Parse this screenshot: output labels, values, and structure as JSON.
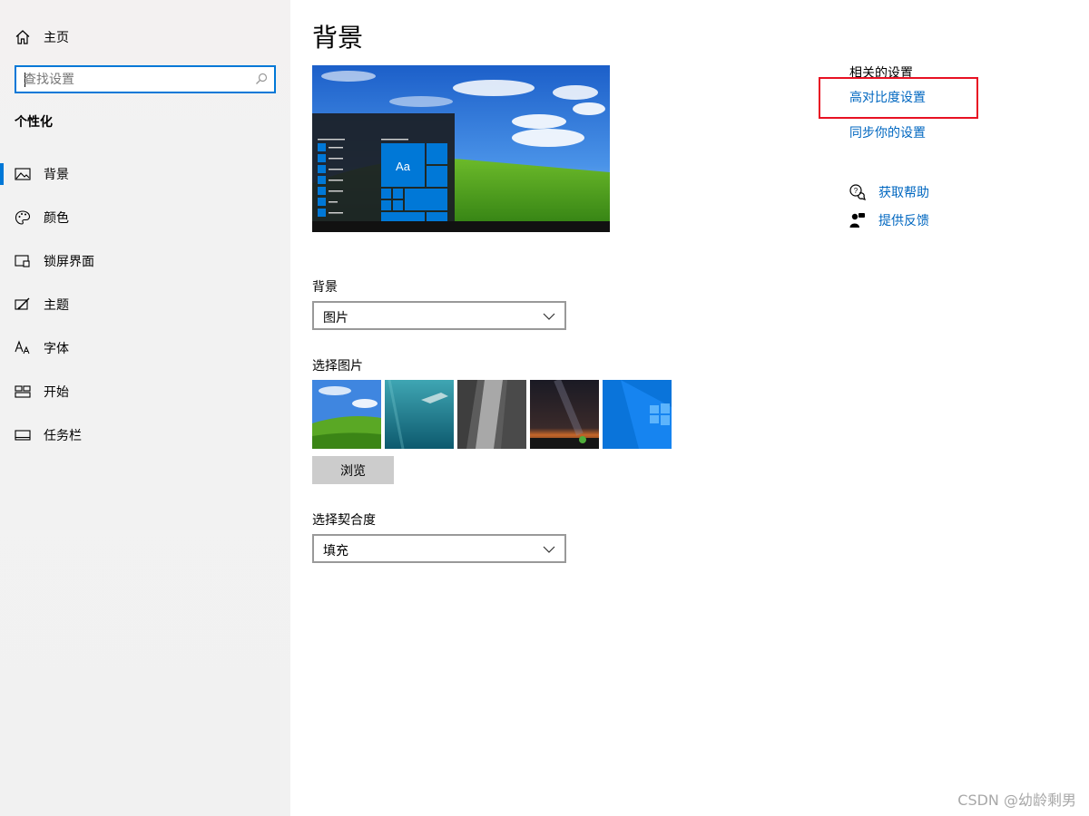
{
  "sidebar": {
    "home_label": "主页",
    "search_placeholder": "查找设置",
    "section_title": "个性化",
    "items": [
      {
        "label": "背景",
        "icon": "picture-icon"
      },
      {
        "label": "颜色",
        "icon": "palette-icon"
      },
      {
        "label": "锁屏界面",
        "icon": "lock-screen-icon"
      },
      {
        "label": "主题",
        "icon": "theme-icon"
      },
      {
        "label": "字体",
        "icon": "font-icon"
      },
      {
        "label": "开始",
        "icon": "start-icon"
      },
      {
        "label": "任务栏",
        "icon": "taskbar-icon"
      }
    ]
  },
  "main": {
    "title": "背景",
    "preview_tile_text": "Aa",
    "background_label": "背景",
    "background_value": "图片",
    "choose_picture_label": "选择图片",
    "browse_label": "浏览",
    "fit_label": "选择契合度",
    "fit_value": "填充"
  },
  "related": {
    "title": "相关的设置",
    "links": [
      "高对比度设置",
      "同步你的设置"
    ],
    "help": [
      {
        "label": "获取帮助",
        "icon": "help-chat-icon"
      },
      {
        "label": "提供反馈",
        "icon": "feedback-icon"
      }
    ]
  },
  "watermark": "CSDN @幼龄剩男",
  "colors": {
    "accent": "#0078d7",
    "link": "#0067c0",
    "highlight_box": "#e81123"
  }
}
